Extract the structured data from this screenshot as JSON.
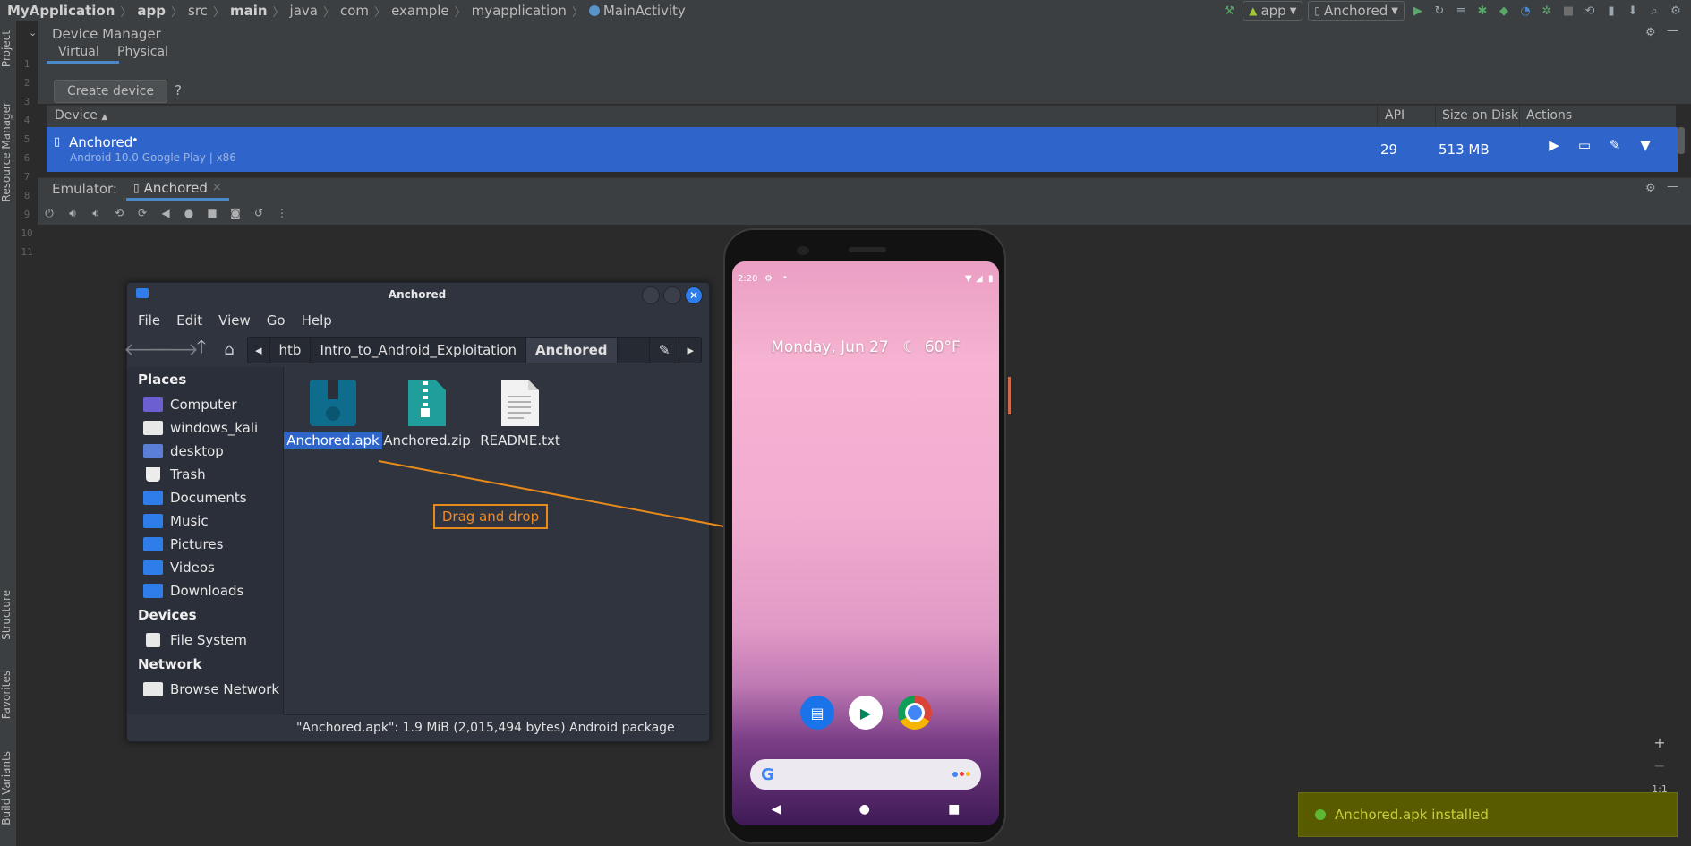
{
  "breadcrumb": [
    "MyApplication",
    "app",
    "src",
    "main",
    "java",
    "com",
    "example",
    "myapplication",
    "MainActivity"
  ],
  "toolbar": {
    "config": "app",
    "device": "Anchored"
  },
  "left_stripe": {
    "project": "Project",
    "resource_manager": "Resource Manager",
    "structure": "Structure",
    "favorites": "Favorites",
    "build_variants": "Build Variants"
  },
  "line_numbers": [
    "1",
    "2",
    "3",
    "4",
    "5",
    "6",
    "7",
    "8",
    "9",
    "10",
    "11"
  ],
  "device_manager": {
    "title": "Device Manager",
    "tabs": [
      "Virtual",
      "Physical"
    ],
    "create_device": "Create device",
    "help": "?",
    "columns": {
      "device": "Device",
      "api": "API",
      "size": "Size on Disk",
      "actions": "Actions"
    },
    "row": {
      "name": "Anchored",
      "dot": "•",
      "subtitle": "Android 10.0 Google Play | x86",
      "api": "29",
      "size": "513 MB"
    }
  },
  "emulator": {
    "label": "Emulator:",
    "tab": "Anchored",
    "tab_close": "×"
  },
  "file_manager": {
    "title": "Anchored",
    "menu": [
      "File",
      "Edit",
      "View",
      "Go",
      "Help"
    ],
    "path": [
      "htb",
      "Intro_to_Android_Exploitation",
      "Anchored"
    ],
    "sections": {
      "places": "Places",
      "devices": "Devices",
      "network": "Network"
    },
    "places": [
      "Computer",
      "windows_kali",
      "desktop",
      "Trash",
      "Documents",
      "Music",
      "Pictures",
      "Videos",
      "Downloads"
    ],
    "devices": [
      "File System"
    ],
    "network": [
      "Browse Network"
    ],
    "files": [
      "Anchored.apk",
      "Anchored.zip",
      "README.txt"
    ],
    "status": "\"Anchored.apk\": 1.9 MiB (2,015,494 bytes) Android package"
  },
  "annotation": "Drag and drop",
  "phone": {
    "time": "2:20",
    "date": "Monday, Jun 27",
    "weather": "60°F"
  },
  "zoom": {
    "plus": "+",
    "minus": "−",
    "ratio": "1:1"
  },
  "notification": "Anchored.apk installed"
}
